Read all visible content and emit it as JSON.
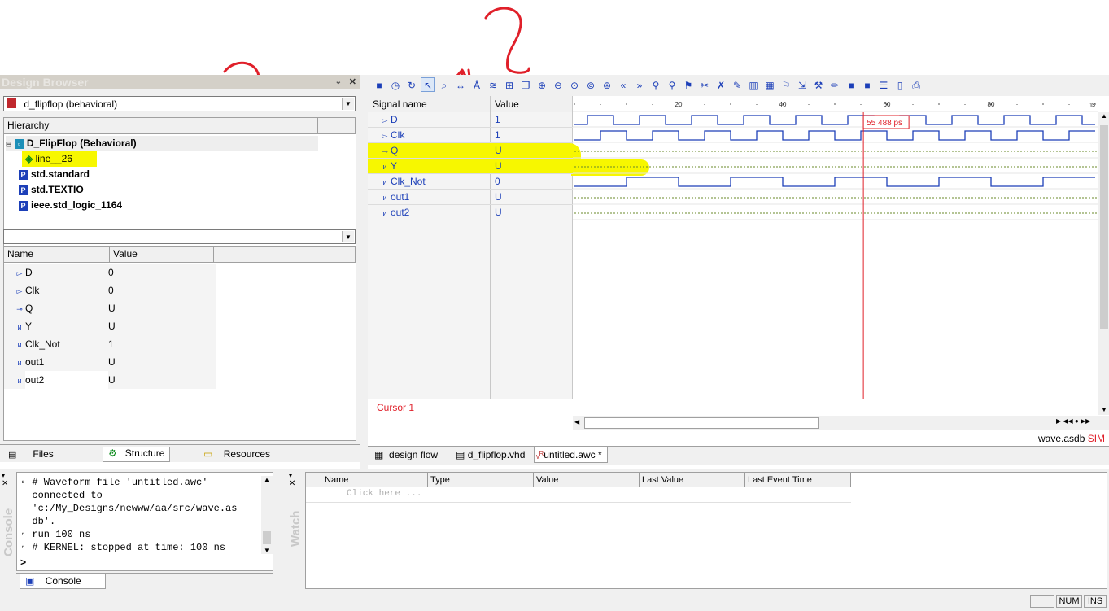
{
  "annotations": {
    "q_mark_1": "?",
    "q_mark_2": "?",
    "o_mark": "o",
    "a_mark": "a"
  },
  "design_browser": {
    "title": "Design Browser",
    "top_combo": "d_flipflop (behavioral)",
    "hierarchy_header": "Hierarchy",
    "tree": [
      {
        "label": "D_FlipFlop (Behavioral)"
      },
      {
        "label": "line__26"
      },
      {
        "label": "std.standard"
      },
      {
        "label": "std.TEXTIO"
      },
      {
        "label": "ieee.std_logic_1164"
      }
    ],
    "name_header": "Name",
    "value_header": "Value",
    "signals": [
      {
        "name": "D",
        "value": "0"
      },
      {
        "name": "Clk",
        "value": "0"
      },
      {
        "name": "Q",
        "value": "U"
      },
      {
        "name": "Y",
        "value": "U"
      },
      {
        "name": "Clk_Not",
        "value": "1"
      },
      {
        "name": "out1",
        "value": "U"
      },
      {
        "name": "out2",
        "value": "U"
      }
    ],
    "tabs": {
      "files": "Files",
      "structure": "Structure",
      "resources": "Resources"
    }
  },
  "waveform": {
    "signal_name_header": "Signal name",
    "value_header": "Value",
    "signals": [
      {
        "name": "D",
        "value": "1"
      },
      {
        "name": "Clk",
        "value": "1"
      },
      {
        "name": "Q",
        "value": "U"
      },
      {
        "name": "Y",
        "value": "U"
      },
      {
        "name": "Clk_Not",
        "value": "0"
      },
      {
        "name": "out1",
        "value": "U"
      },
      {
        "name": "out2",
        "value": "U"
      }
    ],
    "ruler": [
      "20",
      "40",
      "60",
      "80",
      "ns"
    ],
    "cursor_label": "Cursor 1",
    "cursor_time": "55 488 ps",
    "file_label": "wave.asdb",
    "sim_label": "SIM",
    "tabs": {
      "design_flow": "design flow",
      "vhd": "d_flipflop.vhd",
      "awc": "untitled.awc *"
    },
    "colors": {
      "wave": "#1c3fb8",
      "cursor": "#e0202a",
      "highlight": "#f7f700"
    }
  },
  "console": {
    "lines": [
      "# Waveform file 'untitled.awc'",
      "connected to",
      "'c:/My_Designs/newww/aa/src/wave.as",
      "db'.",
      "run 100 ns",
      "# KERNEL: stopped at time: 100 ns"
    ],
    "prompt": ">",
    "side_label": "Console",
    "tab": "Console"
  },
  "watch": {
    "side_label": "Watch",
    "columns": [
      "Name",
      "Type",
      "Value",
      "Last Value",
      "Last Event Time"
    ],
    "placeholder": "Click here ..."
  },
  "status": {
    "num": "NUM",
    "ins": "INS"
  },
  "toolbar_icons": [
    "save-icon",
    "clock-icon",
    "run-icon",
    "pointer-icon",
    "zoom-icon",
    "measure-icon",
    "text-icon",
    "bus-icon",
    "add-signal-icon",
    "copy-icon",
    "zoom-in-icon",
    "zoom-out-icon",
    "zoom-fit-icon",
    "zoom-range-icon",
    "zoom-area-icon",
    "prev-icon",
    "next-icon",
    "find-icon",
    "find-next-icon",
    "marker-icon",
    "cut-icon",
    "delete-icon",
    "edit-icon",
    "binary-icon",
    "format-icon",
    "flag-icon",
    "export-icon",
    "tools-icon",
    "pen-icon",
    "block-icon",
    "block-icon-2",
    "properties-icon",
    "page-icon",
    "print-icon"
  ]
}
